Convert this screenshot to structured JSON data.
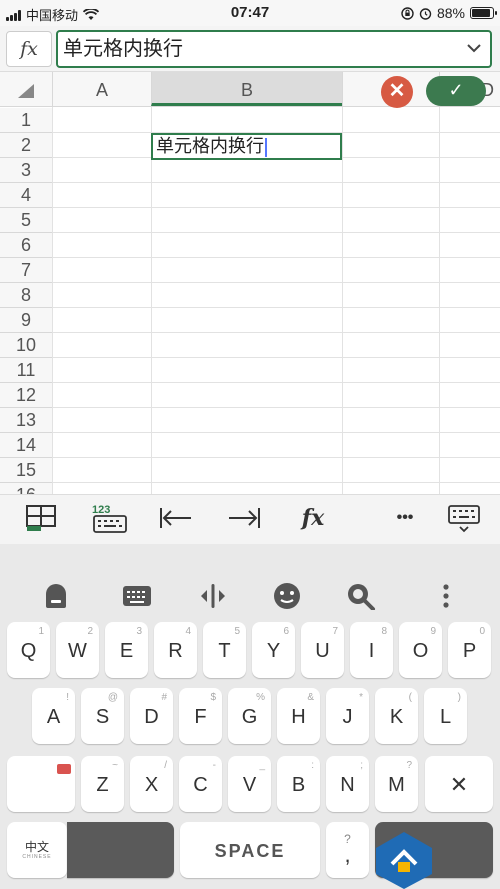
{
  "status_bar": {
    "carrier": "中国移动",
    "time": "07:47",
    "battery": "88%",
    "battery_level": 0.88
  },
  "formula_bar": {
    "fx_label": "fx",
    "value": "单元格内换行"
  },
  "columns": [
    "A",
    "B",
    "D"
  ],
  "rows": [
    "1",
    "2",
    "3",
    "4",
    "5",
    "6",
    "7",
    "8",
    "9",
    "10",
    "11",
    "12",
    "13",
    "14",
    "15",
    "16"
  ],
  "active_cell": {
    "column": "B",
    "row": "2",
    "value": "单元格内换行"
  },
  "toolbar": {
    "fx_label": "fx",
    "more_label": "•••",
    "numeric_label": "123"
  },
  "keyboard": {
    "row1": [
      {
        "key": "Q",
        "sup": "1"
      },
      {
        "key": "W",
        "sup": "2"
      },
      {
        "key": "E",
        "sup": "3"
      },
      {
        "key": "R",
        "sup": "4"
      },
      {
        "key": "T",
        "sup": "5"
      },
      {
        "key": "Y",
        "sup": "6"
      },
      {
        "key": "U",
        "sup": "7"
      },
      {
        "key": "I",
        "sup": "8"
      },
      {
        "key": "O",
        "sup": "9"
      },
      {
        "key": "P",
        "sup": "0"
      }
    ],
    "row2": [
      {
        "key": "A",
        "sup": "!"
      },
      {
        "key": "S",
        "sup": "@"
      },
      {
        "key": "D",
        "sup": "#"
      },
      {
        "key": "F",
        "sup": "$"
      },
      {
        "key": "G",
        "sup": "%"
      },
      {
        "key": "H",
        "sup": "&"
      },
      {
        "key": "J",
        "sup": "*"
      },
      {
        "key": "K",
        "sup": "("
      },
      {
        "key": "L",
        "sup": ")"
      }
    ],
    "row3": [
      {
        "key": "Z",
        "sup": "~"
      },
      {
        "key": "X",
        "sup": "/"
      },
      {
        "key": "C",
        "sup": "-"
      },
      {
        "key": "V",
        "sup": "_"
      },
      {
        "key": "B",
        "sup": ":"
      },
      {
        "key": "N",
        "sup": ";"
      },
      {
        "key": "M",
        "sup": "?"
      }
    ],
    "lang_label": "中文",
    "lang_sub": "CHINESE",
    "space_label": "SPACE",
    "punct_main": ",",
    "punct_sup": "?"
  },
  "colors": {
    "accent": "#2f7d4c",
    "cancel": "#d75a43",
    "confirm": "#3c7a4f"
  }
}
